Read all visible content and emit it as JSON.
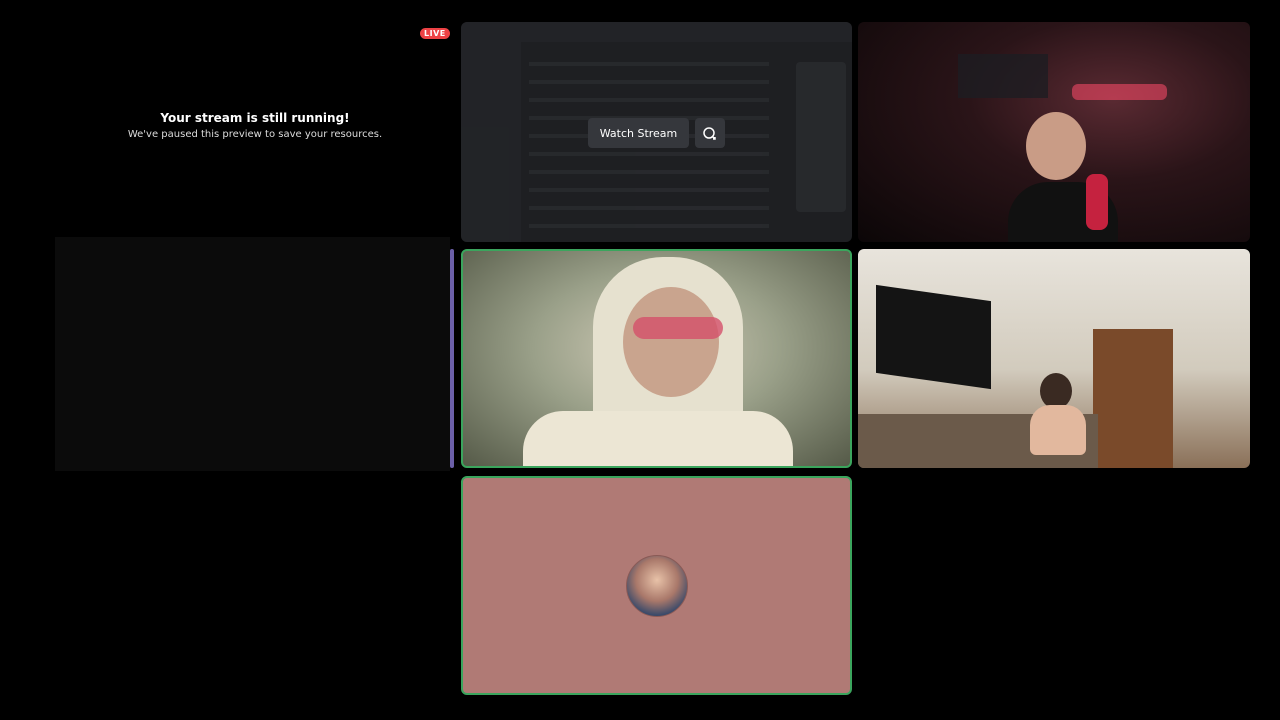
{
  "paused_preview": {
    "live_badge": "LIVE",
    "title": "Your stream is still running!",
    "subtitle": "We've paused this preview to save your resources."
  },
  "screen_share": {
    "watch_button_label": "Watch Stream",
    "popout_icon": "popout-icon"
  },
  "colors": {
    "live": "#ed4245",
    "speaking_border": "#3ba55d",
    "avatar_tile_bg": "#b07a75",
    "background": "#000000"
  }
}
